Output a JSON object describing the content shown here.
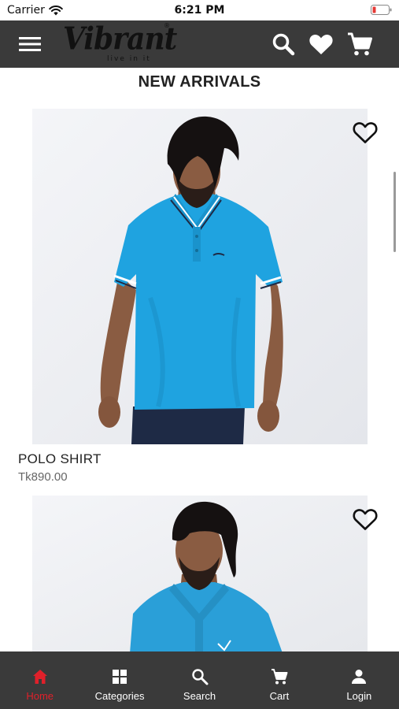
{
  "status_bar": {
    "carrier": "Carrier",
    "time": "6:21 PM"
  },
  "header": {
    "logo_text": "Vibrant",
    "logo_tagline": "live in it",
    "logo_reg_mark": "®"
  },
  "section_title": "NEW ARRIVALS",
  "products": [
    {
      "name": "POLO SHIRT",
      "price": "Tk890.00"
    }
  ],
  "bottom_nav": {
    "items": [
      {
        "label": "Home",
        "icon": "home-icon",
        "active": true
      },
      {
        "label": "Categories",
        "icon": "grid-icon",
        "active": false
      },
      {
        "label": "Search",
        "icon": "search-icon",
        "active": false
      },
      {
        "label": "Cart",
        "icon": "cart-icon",
        "active": false
      },
      {
        "label": "Login",
        "icon": "person-icon",
        "active": false
      }
    ]
  },
  "colors": {
    "header_bg": "#3a3a3a",
    "active_nav": "#e0202a",
    "shirt": "#1fa3e0",
    "battery_low": "#e53935"
  }
}
